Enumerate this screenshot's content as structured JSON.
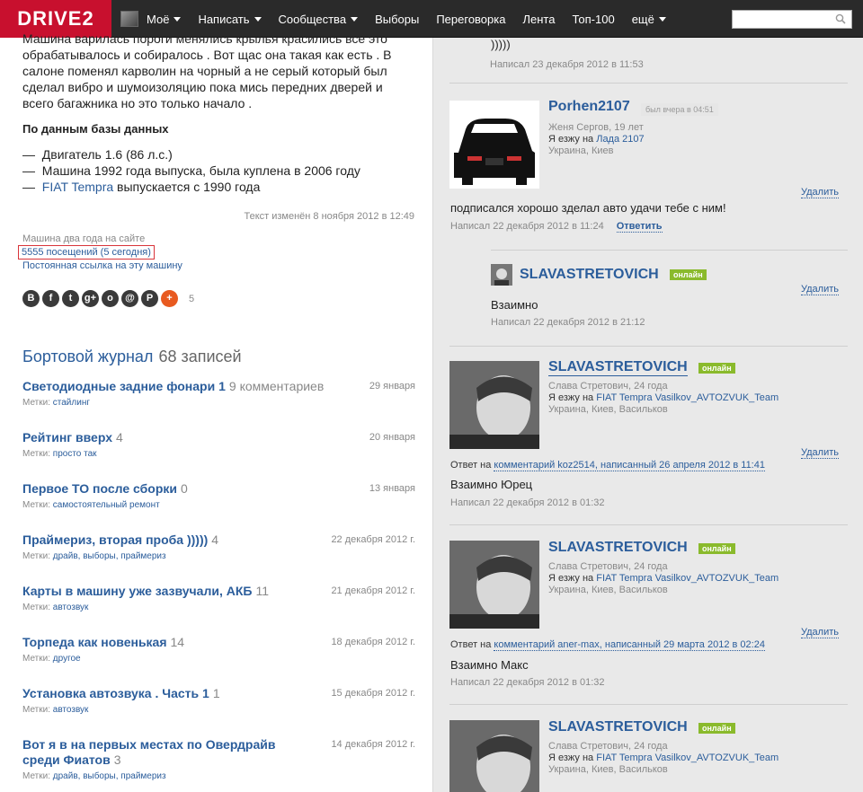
{
  "header": {
    "logo": "DRIVE2",
    "nav": [
      {
        "label": "Моё",
        "dropdown": true
      },
      {
        "label": "Написать",
        "dropdown": true
      },
      {
        "label": "Сообщества",
        "dropdown": true
      },
      {
        "label": "Выборы",
        "dropdown": false
      },
      {
        "label": "Переговорка",
        "dropdown": false
      },
      {
        "label": "Лента",
        "dropdown": false
      },
      {
        "label": "Топ-100",
        "dropdown": false
      },
      {
        "label": "ещё",
        "dropdown": true
      }
    ],
    "search_placeholder": ""
  },
  "car": {
    "description_lines": [
      "Машина варилась пороги менялись крылья красились все это",
      "обрабатывалось и собиралось . Вот щас она такая как есть . В",
      "салоне поменял карволин на чорный а не серый который был",
      "сделал вибро и шумоизоляцию пока мись передних дверей и",
      "всего багажника но это только начало ."
    ],
    "db_title": "По данным базы данных",
    "facts": [
      {
        "dash": "—",
        "link": "",
        "text": "Двигатель 1.6 (86 л.с.)"
      },
      {
        "dash": "—",
        "link": "",
        "text": "Машина 1992 года выпуска, была куплена в 2006 году"
      },
      {
        "dash": "—",
        "link": "FIAT Tempra",
        "text": " выпускается с 1990 года"
      }
    ],
    "edited": "Текст изменён 8 ноября 2012 в 12:49",
    "age": "Машина два года на сайте",
    "visits": "5555 посещений (5 сегодня)",
    "permalink": "Постоянная ссылка на эту машину",
    "share_count": "5",
    "social": [
      {
        "icon": "vk-icon",
        "glyph": "B"
      },
      {
        "icon": "facebook-icon",
        "glyph": "f"
      },
      {
        "icon": "twitter-icon",
        "glyph": "t"
      },
      {
        "icon": "google-plus-icon",
        "glyph": "g+"
      },
      {
        "icon": "odnoklassniki-icon",
        "glyph": "о"
      },
      {
        "icon": "mail-icon",
        "glyph": "@"
      },
      {
        "icon": "pinterest-icon",
        "glyph": "P"
      },
      {
        "icon": "more-share-icon",
        "glyph": "+"
      }
    ]
  },
  "journal": {
    "title": "Бортовой журнал",
    "count": "68 записей",
    "tags_label": "Метки:",
    "entries": [
      {
        "title": "Светодиодные задние фонари 1",
        "comments": "9 комментариев",
        "date": "29 января",
        "tags": "стайлинг"
      },
      {
        "title": "Рейтинг вверх",
        "comments": "4",
        "date": "20 января",
        "tags": "просто так"
      },
      {
        "title": "Первое ТО после сборки",
        "comments": "0",
        "date": "13 января",
        "tags": "самостоятельный ремонт"
      },
      {
        "title": "Праймериз, вторая проба )))))",
        "comments": "4",
        "date": "22 декабря 2012 г.",
        "tags": "драйв, выборы, праймериз"
      },
      {
        "title": "Карты в машину уже зазвучали, АКБ",
        "comments": "11",
        "date": "21 декабря 2012 г.",
        "tags": "автозвук"
      },
      {
        "title": "Торпеда как новенькая",
        "comments": "14",
        "date": "18 декабря 2012 г.",
        "tags": "другое"
      },
      {
        "title": "Установка автозвука . Часть 1",
        "comments": "1",
        "date": "15 декабря 2012 г.",
        "tags": "автозвук"
      },
      {
        "title": "Вот я в на первых местах по Овердрайв среди Фиатов",
        "comments": "3",
        "date": "14 декабря 2012 г.",
        "tags": "драйв, выборы, праймериз"
      }
    ]
  },
  "comments": {
    "delete_label": "Удалить",
    "reply_label": "Ответить",
    "online_label": "онлайн",
    "drive_label": "Я езжу на",
    "answer_label": "Ответ на",
    "answer_link": "комментарий",
    "c0": {
      "text": ")))))",
      "meta": "Написал 23 декабря 2012 в 11:53"
    },
    "c1": {
      "username": "Porhen2107",
      "seen": "был вчера в 04:51",
      "info": "Женя Сергов, 19 лет",
      "car": "Лада 2107",
      "location": "Украина, Киев",
      "text": "подписался хорошо зделал авто удачи тебе с ним!",
      "meta": "Написал 22 декабря 2012 в 11:24"
    },
    "c2": {
      "username": "SLAVASTRETOVICH",
      "text": "Взаимно",
      "meta": "Написал 22 декабря 2012 в 21:12"
    },
    "c3": {
      "username": "SLAVASTRETOVICH",
      "info": "Слава Стретович, 24 года",
      "car": "FIAT Tempra Vasilkov_AVTOZVUK_Team",
      "location": "Украина, Киев, Васильков",
      "answer_user": "koz2514",
      "answer_rest": ", написанный 26 апреля 2012 в 11:41",
      "text": "Взаимно Юрец",
      "meta": "Написал 22 декабря 2012 в 01:32"
    },
    "c4": {
      "username": "SLAVASTRETOVICH",
      "info": "Слава Стретович, 24 года",
      "car": "FIAT Tempra Vasilkov_AVTOZVUK_Team",
      "location": "Украина, Киев, Васильков",
      "answer_user": "aner-max",
      "answer_rest": ", написанный 29 марта 2012 в 02:24",
      "text": "Взаимно Макс",
      "meta": "Написал 22 декабря 2012 в 01:32"
    },
    "c5": {
      "username": "SLAVASTRETOVICH",
      "info": "Слава Стретович, 24 года",
      "car": "FIAT Tempra Vasilkov_AVTOZVUK_Team",
      "location": "Украина, Киев, Васильков"
    }
  }
}
